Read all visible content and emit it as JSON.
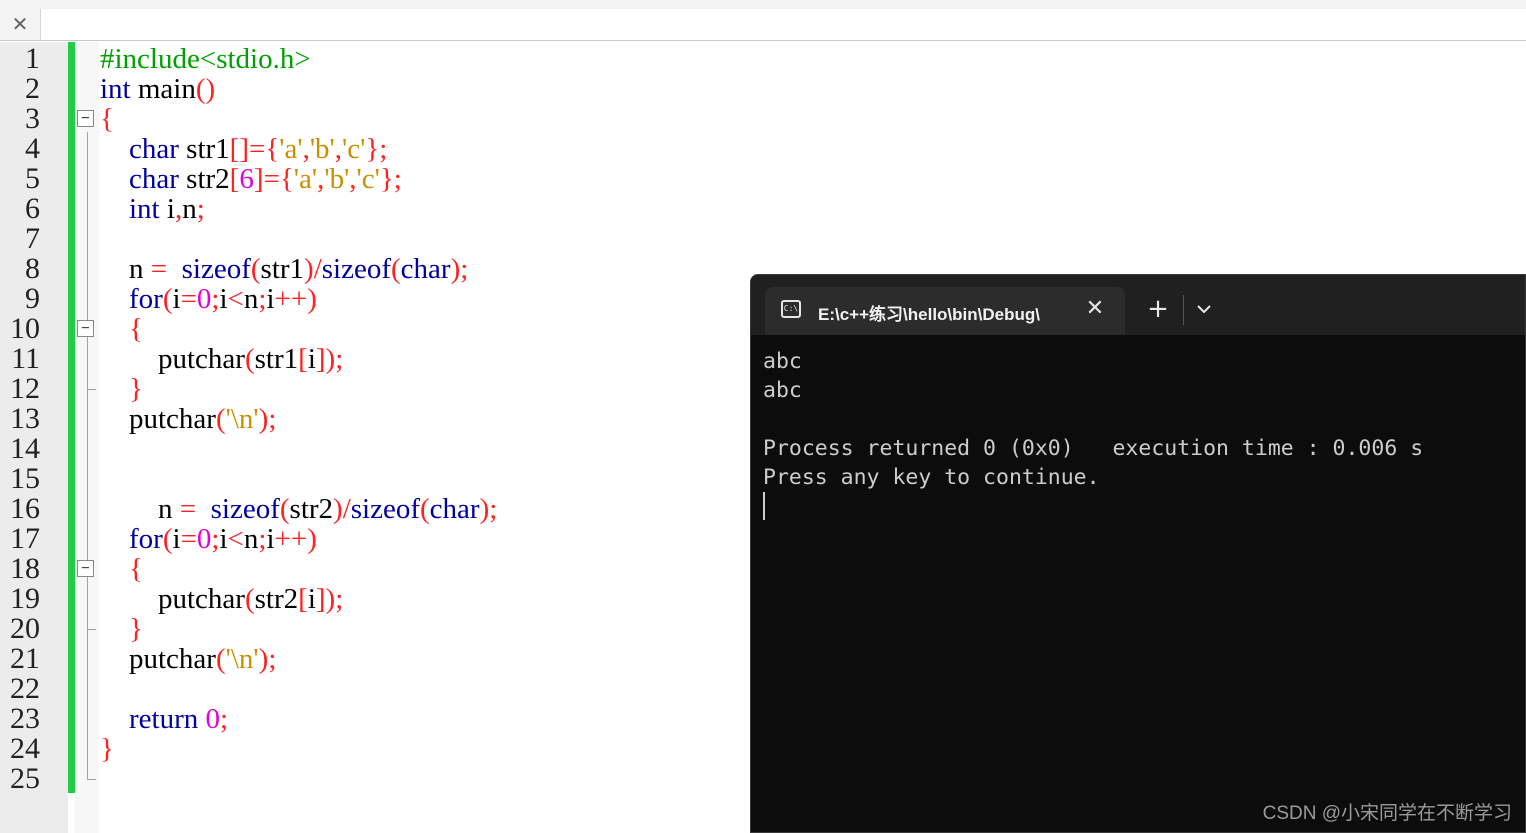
{
  "editor": {
    "tab_close_glyph": "✕",
    "line_numbers": [
      "1",
      "2",
      "3",
      "4",
      "5",
      "6",
      "7",
      "8",
      "9",
      "10",
      "11",
      "12",
      "13",
      "14",
      "15",
      "16",
      "17",
      "18",
      "19",
      "20",
      "21",
      "22",
      "23",
      "24",
      "25"
    ],
    "lines": [
      [
        [
          "pp",
          "#include<stdio.h>"
        ]
      ],
      [
        [
          "kw",
          "int"
        ],
        [
          "",
          "main"
        ],
        [
          "op",
          "()"
        ]
      ],
      [
        [
          "op",
          "{"
        ]
      ],
      [
        [
          "",
          "    "
        ],
        [
          "kw",
          "char"
        ],
        [
          "",
          "str1"
        ],
        [
          "op",
          "[]={"
        ],
        [
          "str",
          "'a'"
        ],
        [
          "op",
          ","
        ],
        [
          "str",
          "'b'"
        ],
        [
          "op",
          ","
        ],
        [
          "str",
          "'c'"
        ],
        [
          "op",
          "};"
        ]
      ],
      [
        [
          "",
          "    "
        ],
        [
          "kw",
          "char"
        ],
        [
          "",
          "str2"
        ],
        [
          "op",
          "["
        ],
        [
          "num",
          "6"
        ],
        [
          "op",
          "]={"
        ],
        [
          "str",
          "'a'"
        ],
        [
          "op",
          ","
        ],
        [
          "str",
          "'b'"
        ],
        [
          "op",
          ","
        ],
        [
          "str",
          "'c'"
        ],
        [
          "op",
          "};"
        ]
      ],
      [
        [
          "",
          "    "
        ],
        [
          "kw",
          "int"
        ],
        [
          "",
          "i"
        ],
        [
          "op",
          ","
        ],
        [
          "",
          "n"
        ],
        [
          "op",
          ";"
        ]
      ],
      [
        [
          "",
          ""
        ]
      ],
      [
        [
          "",
          "    n "
        ],
        [
          "op",
          "="
        ],
        [
          "",
          "  "
        ],
        [
          "kw",
          "sizeof"
        ],
        [
          "op",
          "("
        ],
        [
          "",
          "str1"
        ],
        [
          "op",
          ")/"
        ],
        [
          "kw",
          "sizeof"
        ],
        [
          "op",
          "("
        ],
        [
          "kw",
          "char"
        ],
        [
          "op",
          ");"
        ]
      ],
      [
        [
          "",
          "    "
        ],
        [
          "kw",
          "for"
        ],
        [
          "op",
          "("
        ],
        [
          "",
          "i"
        ],
        [
          "op",
          "="
        ],
        [
          "num",
          "0"
        ],
        [
          "op",
          ";"
        ],
        [
          "",
          "i"
        ],
        [
          "op",
          "<"
        ],
        [
          "",
          "n"
        ],
        [
          "op",
          ";"
        ],
        [
          "",
          "i"
        ],
        [
          "op",
          "++)"
        ]
      ],
      [
        [
          "",
          "    "
        ],
        [
          "op",
          "{"
        ]
      ],
      [
        [
          "",
          "        putchar"
        ],
        [
          "op",
          "("
        ],
        [
          "",
          "str1"
        ],
        [
          "op",
          "["
        ],
        [
          "",
          "i"
        ],
        [
          "op",
          "]);"
        ]
      ],
      [
        [
          "",
          "    "
        ],
        [
          "op",
          "}"
        ]
      ],
      [
        [
          "",
          "    putchar"
        ],
        [
          "op",
          "("
        ],
        [
          "str",
          "'\\n'"
        ],
        [
          "op",
          ");"
        ]
      ],
      [
        [
          "",
          ""
        ]
      ],
      [
        [
          "",
          ""
        ]
      ],
      [
        [
          "",
          "        n "
        ],
        [
          "op",
          "="
        ],
        [
          "",
          "  "
        ],
        [
          "kw",
          "sizeof"
        ],
        [
          "op",
          "("
        ],
        [
          "",
          "str2"
        ],
        [
          "op",
          ")/"
        ],
        [
          "kw",
          "sizeof"
        ],
        [
          "op",
          "("
        ],
        [
          "kw",
          "char"
        ],
        [
          "op",
          ");"
        ]
      ],
      [
        [
          "",
          "    "
        ],
        [
          "kw",
          "for"
        ],
        [
          "op",
          "("
        ],
        [
          "",
          "i"
        ],
        [
          "op",
          "="
        ],
        [
          "num",
          "0"
        ],
        [
          "op",
          ";"
        ],
        [
          "",
          "i"
        ],
        [
          "op",
          "<"
        ],
        [
          "",
          "n"
        ],
        [
          "op",
          ";"
        ],
        [
          "",
          "i"
        ],
        [
          "op",
          "++)"
        ]
      ],
      [
        [
          "",
          "    "
        ],
        [
          "op",
          "{"
        ]
      ],
      [
        [
          "",
          "        putchar"
        ],
        [
          "op",
          "("
        ],
        [
          "",
          "str2"
        ],
        [
          "op",
          "["
        ],
        [
          "",
          "i"
        ],
        [
          "op",
          "]);"
        ]
      ],
      [
        [
          "",
          "    "
        ],
        [
          "op",
          "}"
        ]
      ],
      [
        [
          "",
          "    putchar"
        ],
        [
          "op",
          "("
        ],
        [
          "str",
          "'\\n'"
        ],
        [
          "op",
          ");"
        ]
      ],
      [
        [
          "",
          ""
        ]
      ],
      [
        [
          "",
          "    "
        ],
        [
          "kw",
          "return"
        ],
        [
          "",
          ""
        ],
        [
          "num",
          " 0"
        ],
        [
          "op",
          ";"
        ]
      ],
      [
        [
          "op",
          "}"
        ]
      ],
      [
        [
          "",
          ""
        ]
      ]
    ]
  },
  "terminal": {
    "tab_title": "E:\\c++练习\\hello\\bin\\Debug\\",
    "tab_icon_text": "C:\\",
    "tab_close_glyph": "✕",
    "new_tab_glyph": "+",
    "output_lines": [
      "abc",
      "abc",
      "",
      "Process returned 0 (0x0)   execution time : 0.006 s",
      "Press any key to continue."
    ]
  },
  "watermark": "CSDN @小宋同学在不断学习",
  "colors": {
    "keyword": "#0000a0",
    "operator": "#ff2020",
    "number": "#e000e0",
    "string": "#c89000",
    "preprocessor": "#00a000",
    "change_bar": "#22cc44",
    "terminal_bg": "#0c0c0c"
  }
}
